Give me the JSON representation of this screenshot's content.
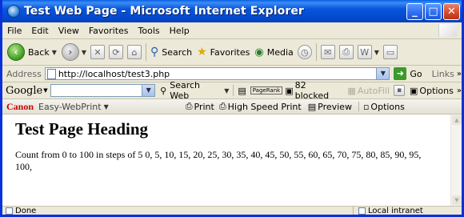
{
  "window": {
    "title": "Test Web Page - Microsoft Internet Explorer"
  },
  "menu": {
    "items": [
      "File",
      "Edit",
      "View",
      "Favorites",
      "Tools",
      "Help"
    ]
  },
  "toolbar": {
    "back_label": "Back",
    "search_label": "Search",
    "favorites_label": "Favorites",
    "media_label": "Media"
  },
  "address": {
    "label": "Address",
    "url": "http://localhost/test3.php",
    "go_label": "Go",
    "links_label": "Links"
  },
  "google": {
    "logo": "Google",
    "search_web_label": "Search Web",
    "pagerank_label": "PageRank",
    "blocked_label": "82 blocked",
    "autofill_label": "AutoFill",
    "options_label": "Options"
  },
  "canon": {
    "brand": "Canon",
    "product": "Easy-WebPrint",
    "print_label": "Print",
    "hsp_label": "High Speed Print",
    "preview_label": "Preview",
    "options_label": "Options"
  },
  "page": {
    "heading": "Test Page Heading",
    "text": "Count from 0 to 100 in steps of 5 0, 5, 10, 15, 20, 25, 30, 35, 40, 45, 50, 55, 60, 65, 70, 75, 80, 85, 90, 95, 100,"
  },
  "status": {
    "left": "Done",
    "zone": "Local intranet"
  }
}
